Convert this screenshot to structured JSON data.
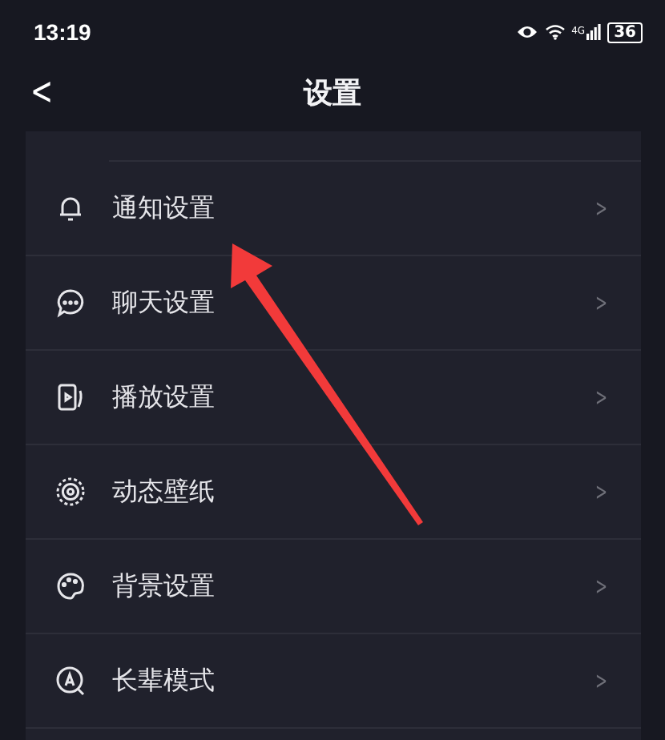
{
  "status_bar": {
    "time": "13:19",
    "network": "4G",
    "battery": "36"
  },
  "header": {
    "back": "<",
    "title": "设置"
  },
  "settings": [
    {
      "label": "通知设置",
      "chevron": ">"
    },
    {
      "label": "聊天设置",
      "chevron": ">"
    },
    {
      "label": "播放设置",
      "chevron": ">"
    },
    {
      "label": "动态壁纸",
      "chevron": ">"
    },
    {
      "label": "背景设置",
      "chevron": ">"
    },
    {
      "label": "长辈模式",
      "chevron": ">"
    }
  ]
}
